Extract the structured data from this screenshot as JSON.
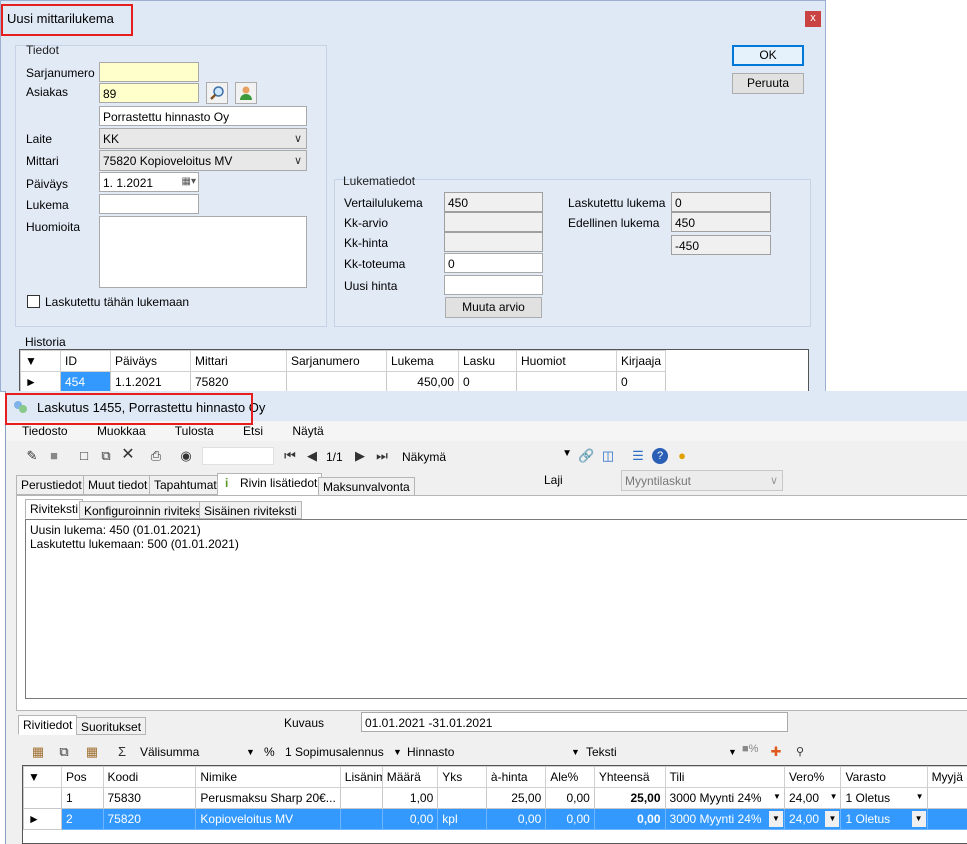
{
  "dialog": {
    "title": "Uusi mittarilukema",
    "close_label": "x",
    "ok_label": "OK",
    "cancel_label": "Peruuta",
    "tiedot": {
      "title": "Tiedot",
      "sarjanumero_label": "Sarjanumero",
      "sarjanumero_value": "",
      "asiakas_label": "Asiakas",
      "asiakas_value": "89",
      "asiakas_name": "Porrastettu hinnasto Oy",
      "laite_label": "Laite",
      "laite_value": "KK",
      "mittari_label": "Mittari",
      "mittari_value": "75820  Kopioveloitus MV",
      "paivays_label": "Päiväys",
      "paivays_value": "1.  1.2021",
      "lukema_label": "Lukema",
      "lukema_value": "",
      "huomioita_label": "Huomioita",
      "huomioita_value": "",
      "checkbox_label": "Laskutettu tähän lukemaan"
    },
    "lukematiedot": {
      "title": "Lukematiedot",
      "vertailu_label": "Vertailulukema",
      "vertailu_value": "450",
      "kkarvio_label": "Kk-arvio",
      "kkarvio_value": "",
      "kkhinta_label": "Kk-hinta",
      "kkhinta_value": "",
      "kktoteuma_label": "Kk-toteuma",
      "kktoteuma_value": "0",
      "uusihinta_label": "Uusi hinta",
      "uusihinta_value": "",
      "muuta_label": "Muuta arvio",
      "laskutettu_label": "Laskutettu lukema",
      "laskutettu_value": "0",
      "edellinen_label": "Edellinen lukema",
      "edellinen_value": "450",
      "ero_value": "-450"
    },
    "historia": {
      "title": "Historia",
      "headers": [
        "ID",
        "Päiväys",
        "Mittari",
        "Sarjanumero",
        "Lukema",
        "Lasku",
        "Huomiot",
        "Kirjaaja"
      ],
      "row": [
        "454",
        "1.1.2021",
        "75820",
        "",
        "450,00",
        "0",
        "",
        "0"
      ]
    }
  },
  "invoice": {
    "title": "Laskutus 1455, Porrastettu hinnasto Oy",
    "menu": [
      "Tiedosto",
      "Muokkaa",
      "Tulosta",
      "Etsi",
      "Näytä"
    ],
    "pager": "1/1",
    "view_label": "Näkymä",
    "tabs": [
      "Perustiedot",
      "Muut tiedot",
      "Tapahtumat",
      "Rivin lisätiedot",
      "Maksunvalvonta"
    ],
    "laji_label": "Laji",
    "laji_value": "Myyntilaskut",
    "subtabs": [
      "Riviteksti",
      "Konfiguroinnin riviteksti",
      "Sisäinen riviteksti"
    ],
    "text_line1": "Uusin lukema: 450  (01.01.2021)",
    "text_line2": "Laskutettu lukemaan: 500 (01.01.2021)",
    "bottom_tabs": [
      "Rivitiedot",
      "Suoritukset"
    ],
    "kuvaus_label": "Kuvaus",
    "kuvaus_value": "01.01.2021 -31.01.2021",
    "toolbar2": {
      "valisumma": "Välisumma",
      "percent": "%",
      "sopimus": "1 Sopimusalennus",
      "hinnasto": "Hinnasto",
      "teksti": "Teksti",
      "percent_icon_label": "%"
    },
    "grid": {
      "headers": [
        "Pos",
        "Koodi",
        "Nimike",
        "Lisänim",
        "Määrä",
        "Yks",
        "à-hinta",
        "Ale%",
        "Yhteensä",
        "Tili",
        "Vero%",
        "Varasto",
        "Myyjä"
      ],
      "rows": [
        [
          "1",
          "75830",
          "Perusmaksu Sharp 20€...",
          "",
          "1,00",
          "",
          "25,00",
          "0,00",
          "25,00",
          "3000 Myynti 24%",
          "24,00",
          "1 Oletus",
          ""
        ],
        [
          "2",
          "75820",
          "Kopioveloitus MV",
          "",
          "0,00",
          "kpl",
          "0,00",
          "0,00",
          "0,00",
          "3000 Myynti 24%",
          "24,00",
          "1 Oletus",
          ""
        ]
      ]
    }
  },
  "colors": {
    "highlight": "#e61e1e",
    "selection": "#3399ff",
    "group_bg": "#dfe8f5",
    "yellow_field": "#ffffcc"
  }
}
